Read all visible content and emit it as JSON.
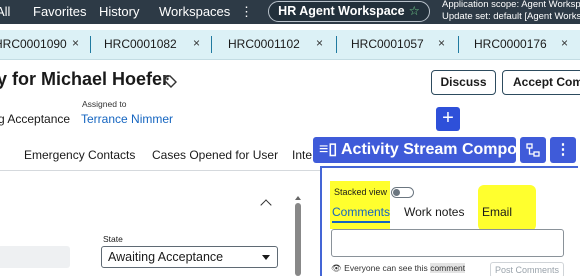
{
  "topbar": {
    "items": [
      "All",
      "Favorites",
      "History",
      "Workspaces",
      "⋮"
    ],
    "workspace_pill": "HR Agent Workspace",
    "scope_line1": "Application scope: Agent Worksp",
    "scope_line2": "Update set: default [Agent Works"
  },
  "tabs": [
    "HRC0001090",
    "HRC0001082",
    "HRC0001102",
    "HRC0001057",
    "HRC0000176"
  ],
  "record": {
    "title": "y for Michael Hoefer",
    "state_fragment": "g Acceptance",
    "assigned_label": "Assigned to",
    "assigned_value": "Terrance Nimmer"
  },
  "actions": {
    "discuss": "Discuss",
    "accept": "Accept Comp"
  },
  "related_tabs": [
    "Emergency Contacts",
    "Cases Opened for User",
    "Inte"
  ],
  "form": {
    "state_label": "State",
    "state_value": "Awaiting Acceptance"
  },
  "activity": {
    "compose_title": "Activity Stream Compose",
    "stacked_view": "Stacked view",
    "tabs": [
      "Comments",
      "Work notes",
      "Email"
    ],
    "visibility_prefix": "Everyone can see this",
    "visibility_word": "comment",
    "post_button": "Post Comments"
  },
  "colors": {
    "topbar": "#2d3a46",
    "tabbar": "#dcf1f6",
    "primary": "#3f5bd9",
    "highlight": "#ffff2e",
    "link": "#1565c0"
  }
}
